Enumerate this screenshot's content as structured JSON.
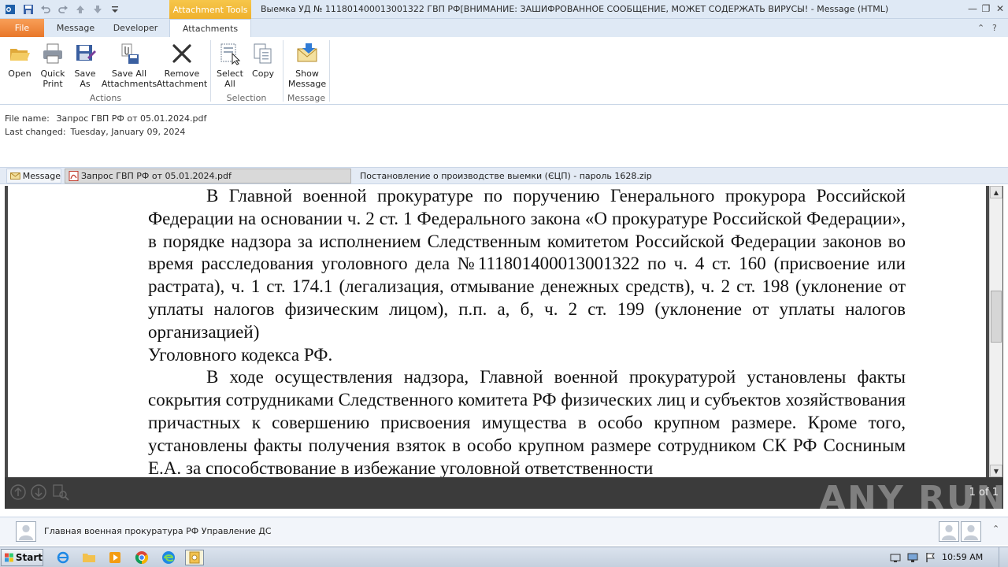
{
  "window": {
    "context_tab_label": "Attachment Tools",
    "title": "Выемка УД № 111801400013001322  ГВП РФ[ВНИМАНИЕ: ЗАШИФРОВАННОЕ СООБЩЕНИЕ, МОЖЕТ СОДЕРЖАТЬ ВИРУСЫ! -  Message (HTML)"
  },
  "tabs": {
    "file": "File",
    "message": "Message",
    "developer": "Developer",
    "attachments": "Attachments"
  },
  "ribbon": {
    "open": "Open",
    "quick_print_1": "Quick",
    "quick_print_2": "Print",
    "save_as_1": "Save",
    "save_as_2": "As",
    "save_all_1": "Save All",
    "save_all_2": "Attachments",
    "remove_1": "Remove",
    "remove_2": "Attachment",
    "select_all_1": "Select",
    "select_all_2": "All",
    "copy": "Copy",
    "show_message_1": "Show",
    "show_message_2": "Message",
    "group_actions": "Actions",
    "group_selection": "Selection",
    "group_message": "Message"
  },
  "file_info": {
    "name_label": "File name:",
    "name_value": "Запрос ГВП РФ от 05.01.2024.pdf",
    "changed_label": "Last changed:",
    "changed_value": "Tuesday, January 09, 2024"
  },
  "attachments": {
    "message": "Message",
    "pdf": "Запрос ГВП РФ от 05.01.2024.pdf",
    "zip": "Постановление о производстве выемки (ЄЦП) - пароль 1628.zip"
  },
  "document": {
    "para1": "В Главной военной прокуратуре по поручению Генерального прокурора Российской Федерации на основании ч. 2 ст. 1 Федерального закона «О прокуратуре Российской Федерации», в порядке надзора за исполнением Следственным комитетом Российской Федерации законов во время расследования уголовного дела №111801400013001322 по ч. 4 ст. 160 (присвоение или растрата), ч. 1 ст. 174.1 (легализация, отмывание денежных средств), ч. 2 ст. 198 (уклонение от уплаты налогов физическим лицом), п.п. а, б, ч. 2 ст. 199 (уклонение от уплаты налогов организацией)",
    "para1_end": "Уголовного кодекса РФ.",
    "para2": "В ходе осуществления надзора, Главной военной прокуратурой установлены факты сокрытия сотрудниками Следственного комитета РФ физических лиц и субъектов хозяйствования причастных к совершению присвоения имущества в особо крупном размере. Кроме того, установлены факты получения взяток в особо крупном размере сотрудником СК РФ Сосниным Е.А. за способствование в избежание уголовной ответственности"
  },
  "pdf_toolbar": {
    "page_count": "1 of 1"
  },
  "watermark": "ANY RUN",
  "people": {
    "sender": "Главная военная прокуратура РФ Управление ДС"
  },
  "taskbar": {
    "start": "Start",
    "clock": "10:59 AM"
  }
}
